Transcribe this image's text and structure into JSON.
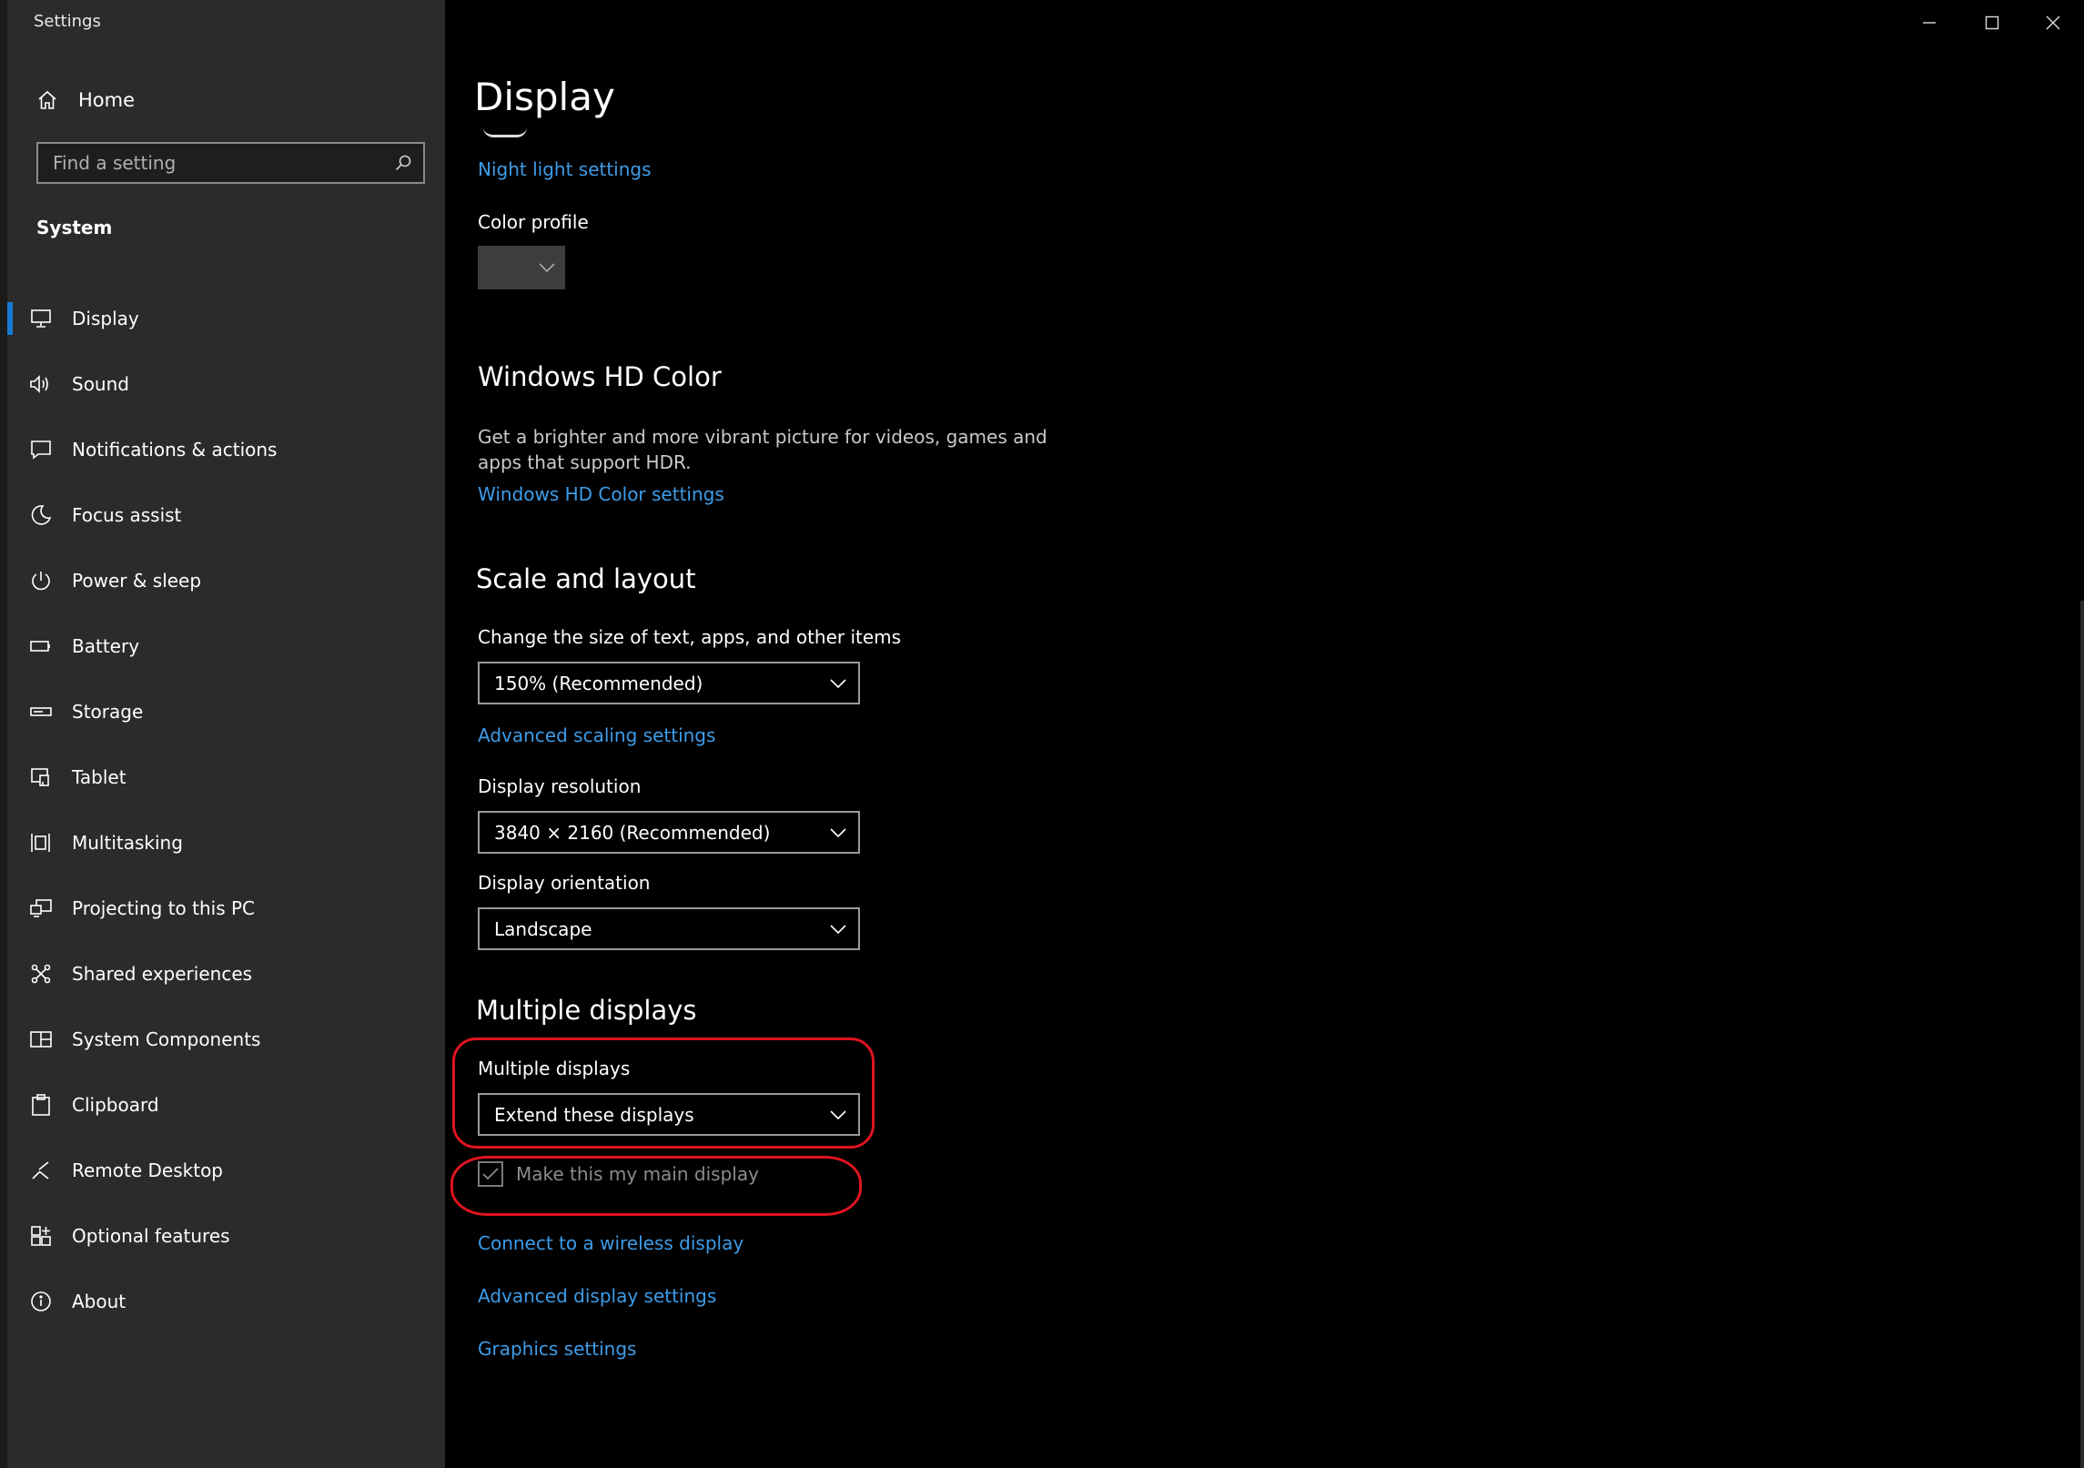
{
  "window": {
    "title": "Settings"
  },
  "sidebar": {
    "home_label": "Home",
    "search_placeholder": "Find a setting",
    "section_label": "System",
    "items": [
      {
        "label": "Display",
        "icon": "monitor-icon",
        "active": true
      },
      {
        "label": "Sound",
        "icon": "speaker-icon"
      },
      {
        "label": "Notifications & actions",
        "icon": "notification-icon"
      },
      {
        "label": "Focus assist",
        "icon": "moon-icon"
      },
      {
        "label": "Power & sleep",
        "icon": "power-icon"
      },
      {
        "label": "Battery",
        "icon": "battery-icon"
      },
      {
        "label": "Storage",
        "icon": "storage-icon"
      },
      {
        "label": "Tablet",
        "icon": "tablet-icon"
      },
      {
        "label": "Multitasking",
        "icon": "multitasking-icon"
      },
      {
        "label": "Projecting to this PC",
        "icon": "projecting-icon"
      },
      {
        "label": "Shared experiences",
        "icon": "shared-experiences-icon"
      },
      {
        "label": "System Components",
        "icon": "system-components-icon"
      },
      {
        "label": "Clipboard",
        "icon": "clipboard-icon"
      },
      {
        "label": "Remote Desktop",
        "icon": "remote-desktop-icon"
      },
      {
        "label": "Optional features",
        "icon": "optional-features-icon"
      },
      {
        "label": "About",
        "icon": "info-icon"
      }
    ]
  },
  "main": {
    "page_title": "Display",
    "night_light_link": "Night light settings",
    "color_profile": {
      "label": "Color profile",
      "value": ""
    },
    "hd_color": {
      "heading": "Windows HD Color",
      "description": "Get a brighter and more vibrant picture for videos, games and apps that support HDR.",
      "link": "Windows HD Color settings"
    },
    "scale_layout": {
      "heading": "Scale and layout",
      "scale_label": "Change the size of text, apps, and other items",
      "scale_value": "150% (Recommended)",
      "advanced_scaling_link": "Advanced scaling settings",
      "resolution_label": "Display resolution",
      "resolution_value": "3840 × 2160 (Recommended)",
      "orientation_label": "Display orientation",
      "orientation_value": "Landscape"
    },
    "multiple_displays": {
      "heading": "Multiple displays",
      "label": "Multiple displays",
      "value": "Extend these displays",
      "main_display_checkbox": "Make this my main display",
      "main_display_checked": true,
      "wireless_link": "Connect to a wireless display",
      "advanced_display_link": "Advanced display settings",
      "graphics_link": "Graphics settings"
    }
  },
  "colors": {
    "accent": "#1a7ad4",
    "link": "#3e9ce8",
    "annotation": "#e0141f",
    "sidebar_bg": "#2b2b2b",
    "content_bg": "#000000"
  }
}
